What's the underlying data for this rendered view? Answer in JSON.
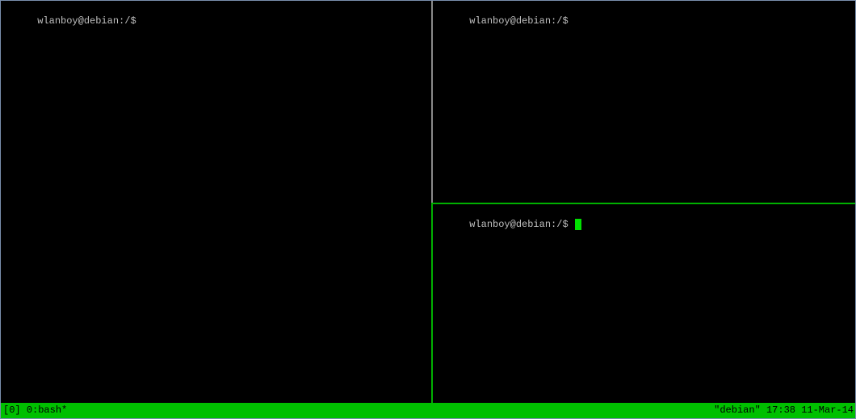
{
  "panes": {
    "left": {
      "prompt": "wlanboy@debian:/$ "
    },
    "top_right": {
      "prompt": "wlanboy@debian:/$ "
    },
    "bottom_right": {
      "prompt": "wlanboy@debian:/$ ",
      "active": true
    }
  },
  "status_bar": {
    "session": "[0]",
    "window": "0:bash*",
    "hostname": "\"debian\"",
    "time": "17:38",
    "date": "11-Mar-14"
  },
  "colors": {
    "background": "#000000",
    "prompt_text": "#c0c0c0",
    "active_border": "#00b000",
    "inactive_border": "#8a8a8a",
    "status_bar_bg": "#00c000",
    "cursor": "#00e000"
  }
}
